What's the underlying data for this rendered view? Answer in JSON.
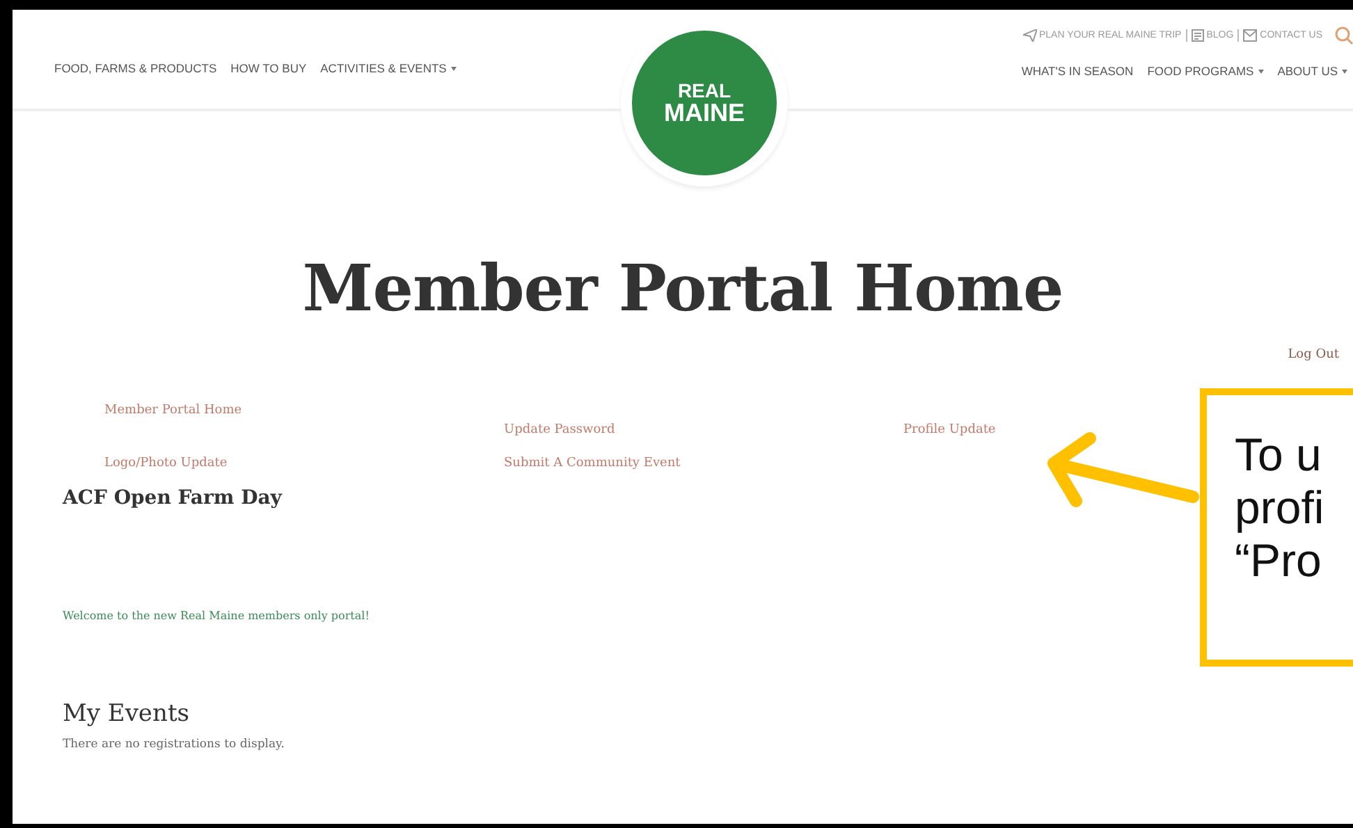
{
  "header": {
    "nav_left": [
      {
        "label": "FOOD, FARMS & PRODUCTS",
        "dropdown": false
      },
      {
        "label": "HOW TO BUY",
        "dropdown": false
      },
      {
        "label": "ACTIVITIES & EVENTS",
        "dropdown": true
      }
    ],
    "utility": [
      {
        "label": "PLAN YOUR REAL MAINE TRIP",
        "kind": "plane"
      },
      {
        "label": "BLOG",
        "kind": "blog"
      },
      {
        "label": "CONTACT US",
        "kind": "mail"
      }
    ],
    "nav_right": [
      {
        "label": "WHAT'S IN SEASON",
        "dropdown": false
      },
      {
        "label": "FOOD PROGRAMS",
        "dropdown": true
      },
      {
        "label": "ABOUT US",
        "dropdown": true
      }
    ],
    "logo": {
      "line1": "REAL",
      "line2": "MAINE"
    }
  },
  "title": "Member Portal Home",
  "logout": "Log Out",
  "portal_links": [
    [
      "Member Portal Home",
      "Logo/Photo Update"
    ],
    [
      "Update Password",
      "Submit A Community Event"
    ],
    [
      "Profile Update"
    ]
  ],
  "event_heading": "ACF Open Farm Day",
  "welcome": "Welcome to the new Real Maine members only portal!",
  "my_events": {
    "heading": "My Events",
    "empty": "There are no registrations to display."
  },
  "callout": {
    "lines": [
      "To u",
      "profi",
      "“Pro"
    ]
  }
}
